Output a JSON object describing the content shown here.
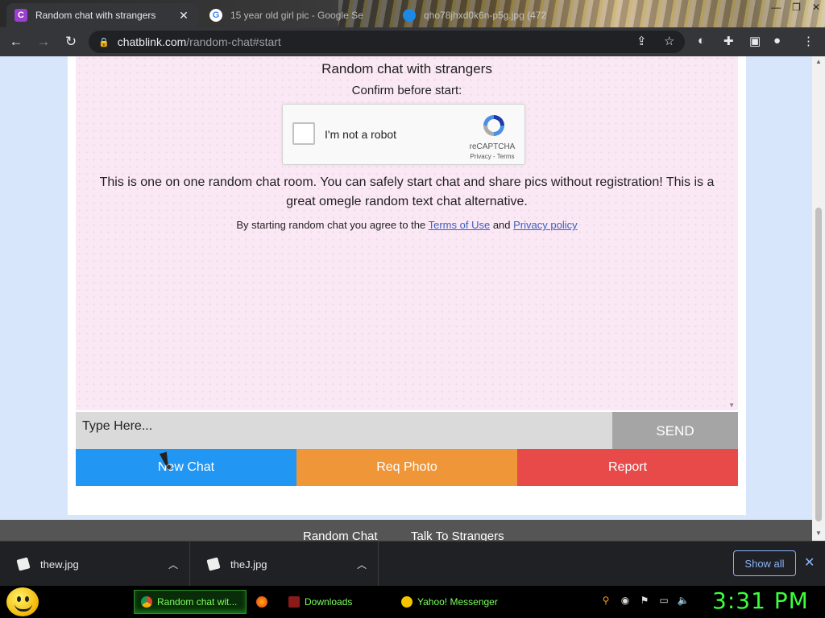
{
  "browser": {
    "tabs": [
      {
        "title": "Random chat with strangers",
        "favicon": "C"
      },
      {
        "title": "15 year old girl pic - Google Se",
        "favicon": "G"
      },
      {
        "title": "qho78jhxd0k6n-p5g.jpg (472",
        "favicon": ""
      }
    ],
    "url_host": "chatblink.com",
    "url_path": "/random-chat#start"
  },
  "page": {
    "heading": "Random chat with strangers",
    "confirm_text": "Confirm before start:",
    "captcha": {
      "label": "I'm not a robot",
      "brand": "reCAPTCHA",
      "privacy": "Privacy",
      "sep": " - ",
      "terms": "Terms"
    },
    "description": "This is one on one random chat room. You can safely start chat and share pics without registration! This is a great omegle random text chat alternative.",
    "agree_prefix": "By starting random chat you agree to the ",
    "terms_link": "Terms of Use",
    "agree_and": " and ",
    "privacy_link": "Privacy policy",
    "input_placeholder": "Type Here...",
    "send_label": "SEND",
    "buttons": {
      "new_chat": "New Chat",
      "req_photo": "Req Photo",
      "report": "Report"
    },
    "footer_links": [
      "Random Chat",
      "Talk To Strangers"
    ]
  },
  "downloads": {
    "items": [
      "thew.jpg",
      "theJ.jpg"
    ],
    "show_all": "Show all"
  },
  "taskbar": {
    "tasks": [
      "Random chat wit...",
      "",
      "Downloads",
      "Yahoo! Messenger"
    ],
    "clock": "3:31 PM"
  },
  "colors": {
    "new_chat": "#2196f3",
    "req_photo": "#ef9638",
    "report": "#e84a4a",
    "send": "#a5a5a5",
    "clock": "#3bff3b"
  }
}
